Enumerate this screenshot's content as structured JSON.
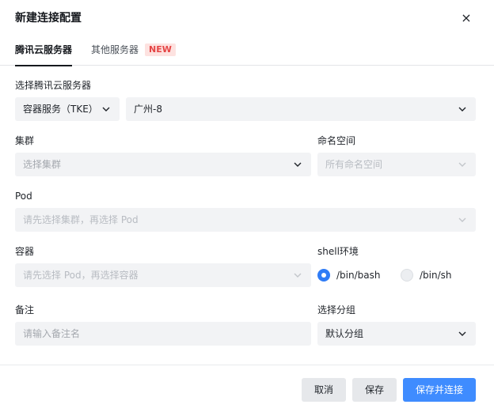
{
  "dialog": {
    "title": "新建连接配置",
    "close_label": "×"
  },
  "tabs": [
    {
      "label": "腾讯云服务器",
      "active": true
    },
    {
      "label": "其他服务器",
      "active": false,
      "badge": "NEW"
    }
  ],
  "server": {
    "label": "选择腾讯云服务器",
    "service_value": "容器服务（TKE）",
    "region_value": "广州-8"
  },
  "cluster": {
    "label": "集群",
    "placeholder": "选择集群"
  },
  "namespace": {
    "label": "命名空间",
    "placeholder": "所有命名空间"
  },
  "pod": {
    "label": "Pod",
    "placeholder": "请先选择集群，再选择 Pod"
  },
  "container": {
    "label": "容器",
    "placeholder": "请先选择 Pod，再选择容器"
  },
  "shell": {
    "label": "shell环境",
    "options": [
      {
        "label": "/bin/bash",
        "checked": true
      },
      {
        "label": "/bin/sh",
        "checked": false
      }
    ]
  },
  "remark": {
    "label": "备注",
    "placeholder": "请输入备注名"
  },
  "group": {
    "label": "选择分组",
    "value": "默认分组"
  },
  "footer": {
    "cancel_label": "取消",
    "save_label": "保存",
    "save_connect_label": "保存并连接"
  },
  "colors": {
    "primary": "#3f8cff",
    "badge_bg": "#fde2e0",
    "badge_text": "#e54545",
    "field_bg": "#f2f3f5"
  }
}
